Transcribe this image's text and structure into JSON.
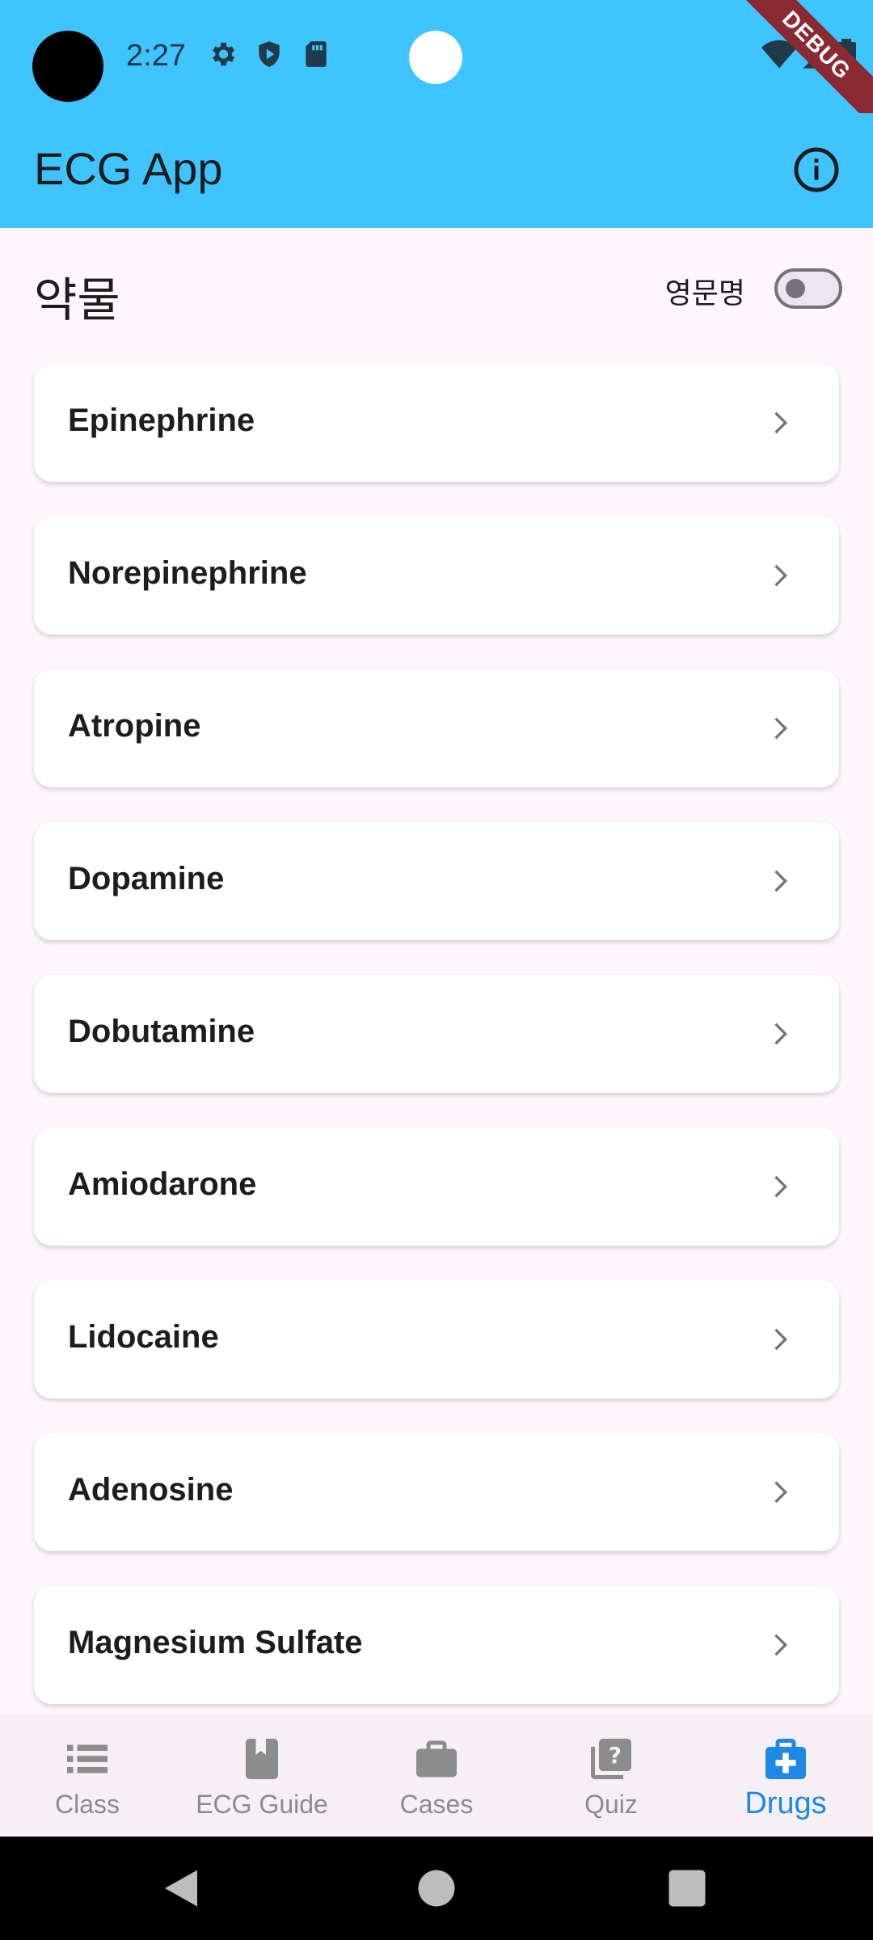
{
  "status_bar": {
    "time": "2:27",
    "icons": [
      "settings-icon",
      "shield-icon",
      "sd-card-icon",
      "wifi-icon",
      "signal-icon",
      "battery-icon"
    ],
    "debug_label": "DEBUG",
    "color": "#40c4ff"
  },
  "app_bar": {
    "title": "ECG App",
    "info_icon": "info-icon"
  },
  "page": {
    "title": "약물",
    "toggle_label": "영문명",
    "toggle_on": false
  },
  "drugs": [
    {
      "name": "Epinephrine"
    },
    {
      "name": "Norepinephrine"
    },
    {
      "name": "Atropine"
    },
    {
      "name": "Dopamine"
    },
    {
      "name": "Dobutamine"
    },
    {
      "name": "Amiodarone"
    },
    {
      "name": "Lidocaine"
    },
    {
      "name": "Adenosine"
    },
    {
      "name": "Magnesium Sulfate"
    }
  ],
  "bottom_nav": {
    "items": [
      {
        "label": "Class",
        "icon": "list-icon"
      },
      {
        "label": "ECG Guide",
        "icon": "book-icon"
      },
      {
        "label": "Cases",
        "icon": "briefcase-icon"
      },
      {
        "label": "Quiz",
        "icon": "quiz-icon"
      },
      {
        "label": "Drugs",
        "icon": "medical-kit-icon"
      }
    ],
    "active": "Drugs",
    "active_color": "#1e88e5"
  }
}
